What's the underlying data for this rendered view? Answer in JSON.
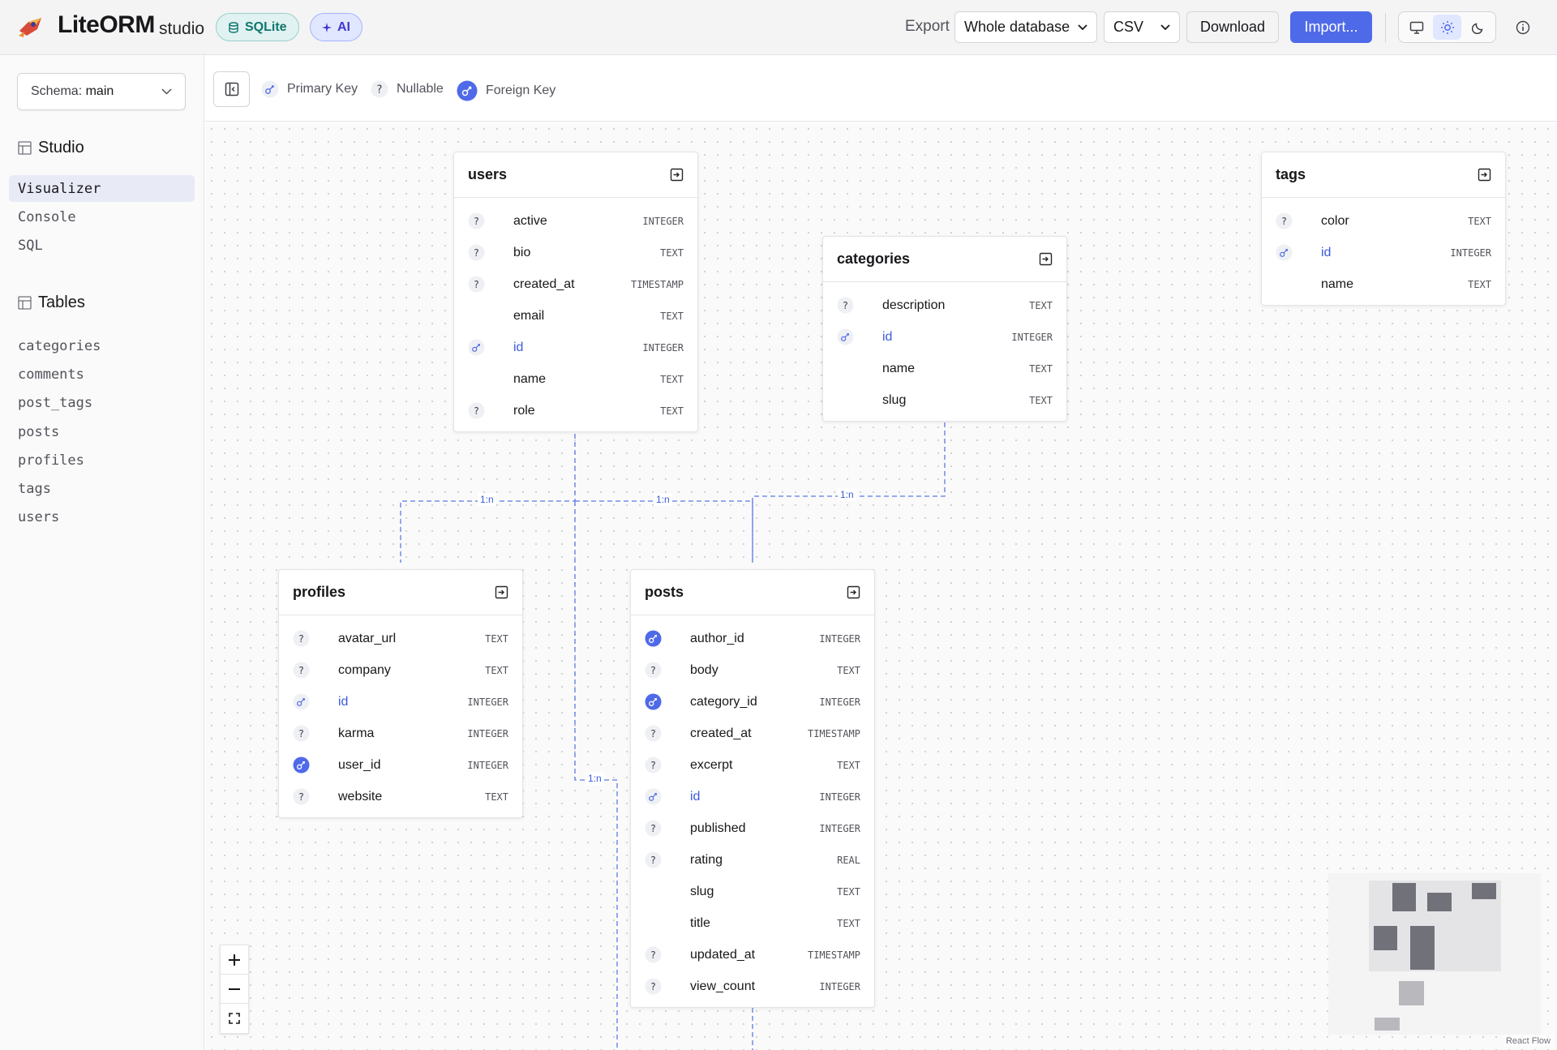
{
  "header": {
    "app_name": "LiteORM",
    "app_sub": "studio",
    "db_badge": "SQLite",
    "ai_badge": "AI",
    "export_label": "Export",
    "export_scope": "Whole database",
    "export_format": "CSV",
    "download_label": "Download",
    "import_label": "Import...",
    "theme_modes": [
      "monitor-icon",
      "sun-icon",
      "moon-icon"
    ],
    "active_theme": "sun-icon"
  },
  "sidebar": {
    "schema_label": "Schema:",
    "schema_value": "main",
    "studio_title": "Studio",
    "studio_items": [
      {
        "label": "Visualizer",
        "active": true
      },
      {
        "label": "Console",
        "active": false
      },
      {
        "label": "SQL",
        "active": false
      }
    ],
    "tables_title": "Tables",
    "table_items": [
      "categories",
      "comments",
      "post_tags",
      "posts",
      "profiles",
      "tags",
      "users"
    ]
  },
  "legend": {
    "primary_key": "Primary Key",
    "nullable": "Nullable",
    "foreign_key": "Foreign Key"
  },
  "tables": {
    "users": {
      "name": "users",
      "columns": [
        {
          "name": "active",
          "type": "INTEGER",
          "kind": "nullable"
        },
        {
          "name": "bio",
          "type": "TEXT",
          "kind": "nullable"
        },
        {
          "name": "created_at",
          "type": "TIMESTAMP",
          "kind": "nullable"
        },
        {
          "name": "email",
          "type": "TEXT",
          "kind": "none"
        },
        {
          "name": "id",
          "type": "INTEGER",
          "kind": "pk"
        },
        {
          "name": "name",
          "type": "TEXT",
          "kind": "none"
        },
        {
          "name": "role",
          "type": "TEXT",
          "kind": "nullable"
        }
      ]
    },
    "categories": {
      "name": "categories",
      "columns": [
        {
          "name": "description",
          "type": "TEXT",
          "kind": "nullable"
        },
        {
          "name": "id",
          "type": "INTEGER",
          "kind": "pk"
        },
        {
          "name": "name",
          "type": "TEXT",
          "kind": "none"
        },
        {
          "name": "slug",
          "type": "TEXT",
          "kind": "none"
        }
      ]
    },
    "tags": {
      "name": "tags",
      "columns": [
        {
          "name": "color",
          "type": "TEXT",
          "kind": "nullable"
        },
        {
          "name": "id",
          "type": "INTEGER",
          "kind": "pk"
        },
        {
          "name": "name",
          "type": "TEXT",
          "kind": "none"
        }
      ]
    },
    "profiles": {
      "name": "profiles",
      "columns": [
        {
          "name": "avatar_url",
          "type": "TEXT",
          "kind": "nullable"
        },
        {
          "name": "company",
          "type": "TEXT",
          "kind": "nullable"
        },
        {
          "name": "id",
          "type": "INTEGER",
          "kind": "pk"
        },
        {
          "name": "karma",
          "type": "INTEGER",
          "kind": "nullable"
        },
        {
          "name": "user_id",
          "type": "INTEGER",
          "kind": "fk"
        },
        {
          "name": "website",
          "type": "TEXT",
          "kind": "nullable"
        }
      ]
    },
    "posts": {
      "name": "posts",
      "columns": [
        {
          "name": "author_id",
          "type": "INTEGER",
          "kind": "fk"
        },
        {
          "name": "body",
          "type": "TEXT",
          "kind": "nullable"
        },
        {
          "name": "category_id",
          "type": "INTEGER",
          "kind": "fk"
        },
        {
          "name": "created_at",
          "type": "TIMESTAMP",
          "kind": "nullable"
        },
        {
          "name": "excerpt",
          "type": "TEXT",
          "kind": "nullable"
        },
        {
          "name": "id",
          "type": "INTEGER",
          "kind": "pk"
        },
        {
          "name": "published",
          "type": "INTEGER",
          "kind": "nullable"
        },
        {
          "name": "rating",
          "type": "REAL",
          "kind": "nullable"
        },
        {
          "name": "slug",
          "type": "TEXT",
          "kind": "none"
        },
        {
          "name": "title",
          "type": "TEXT",
          "kind": "none"
        },
        {
          "name": "updated_at",
          "type": "TIMESTAMP",
          "kind": "nullable"
        },
        {
          "name": "view_count",
          "type": "INTEGER",
          "kind": "nullable"
        }
      ]
    }
  },
  "relations": {
    "users_profiles": "1:n",
    "users_posts": "1:n",
    "categories_posts": "1:n",
    "posts_lower": "1:n"
  },
  "attribution": "React Flow",
  "colors": {
    "accent": "#4f6ae8",
    "pk_text": "#3b5bdb",
    "edge": "#5b7be8"
  }
}
